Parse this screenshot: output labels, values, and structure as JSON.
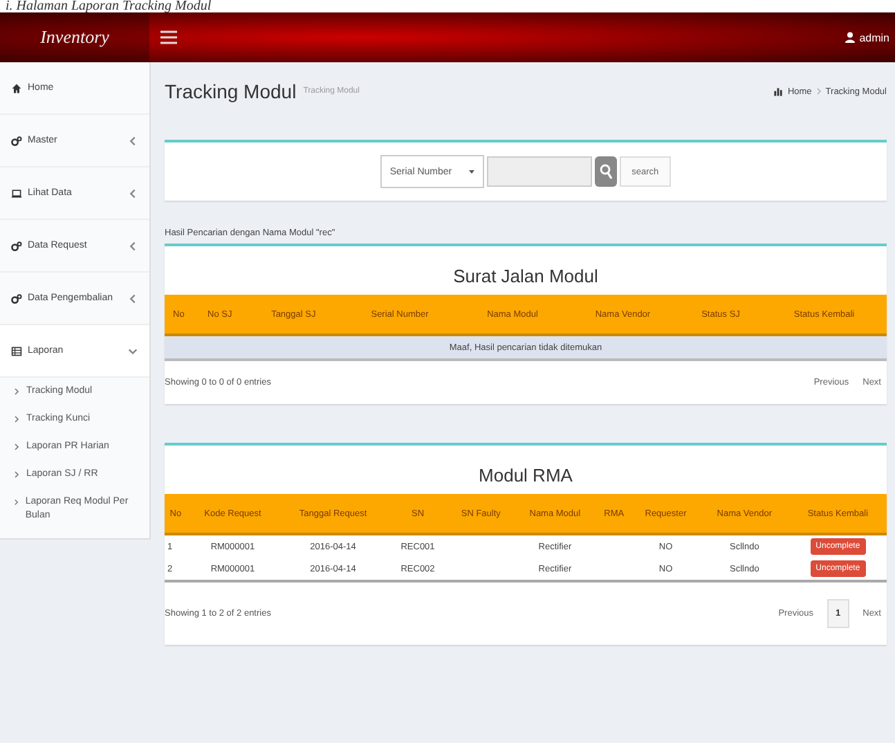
{
  "caption": "i. Halaman Laporan Tracking Modul",
  "header": {
    "brand": "Inventory",
    "user": "admin"
  },
  "sidebar": {
    "items": [
      {
        "label": "Home"
      },
      {
        "label": "Master",
        "expanded": false
      },
      {
        "label": "Lihat Data",
        "expanded": false
      },
      {
        "label": "Data Request",
        "expanded": false
      },
      {
        "label": "Data Pengembalian",
        "expanded": false
      },
      {
        "label": "Laporan",
        "expanded": true,
        "children": [
          {
            "label": "Tracking Modul"
          },
          {
            "label": "Tracking Kunci"
          },
          {
            "label": "Laporan PR Harian"
          },
          {
            "label": "Laporan SJ / RR"
          },
          {
            "label": "Laporan Req Modul Per Bulan"
          }
        ]
      }
    ]
  },
  "page": {
    "title": "Tracking Modul",
    "subtitle": "Tracking Modul",
    "breadcrumb": [
      "Home",
      "Tracking Modul"
    ]
  },
  "search": {
    "select": "Serial Number",
    "button": "search"
  },
  "result_note": "Hasil Pencarian dengan Nama Modul \"rec\"",
  "surat_jalan": {
    "title": "Surat Jalan Modul",
    "columns": [
      "No",
      "No SJ",
      "Tanggal SJ",
      "Serial Number",
      "Nama Modul",
      "Nama Vendor",
      "Status SJ",
      "Status Kembali"
    ],
    "empty": "Maaf, Hasil pencarian tidak ditemukan",
    "info": "Showing 0 to 0 of 0 entries",
    "pagination": [
      {
        "label": "Previous",
        "kind": "link",
        "selected": false
      },
      {
        "label": "Next",
        "kind": "link",
        "selected": false
      }
    ]
  },
  "rma": {
    "title": "Modul RMA",
    "columns": [
      "No",
      "Kode Request",
      "Tanggal Request",
      "SN",
      "SN Faulty",
      "Nama Modul",
      "RMA",
      "Requester",
      "Nama Vendor",
      "Status Kembali"
    ],
    "rows": [
      [
        "1",
        "RM000001",
        "2016-04-14",
        "REC001",
        "",
        "Rectifier",
        "",
        "NO",
        "Scllndo",
        "Uncomplete"
      ],
      [
        "2",
        "RM000001",
        "2016-04-14",
        "REC002",
        "",
        "Rectifier",
        "",
        "NO",
        "Scllndo",
        "Uncomplete"
      ]
    ],
    "info": "Showing 1 to 2 of 2 entries",
    "pagination": [
      {
        "label": "Previous",
        "kind": "link",
        "selected": false
      },
      {
        "label": "1",
        "kind": "page",
        "selected": true
      },
      {
        "label": "Next",
        "kind": "link",
        "selected": false
      }
    ]
  }
}
